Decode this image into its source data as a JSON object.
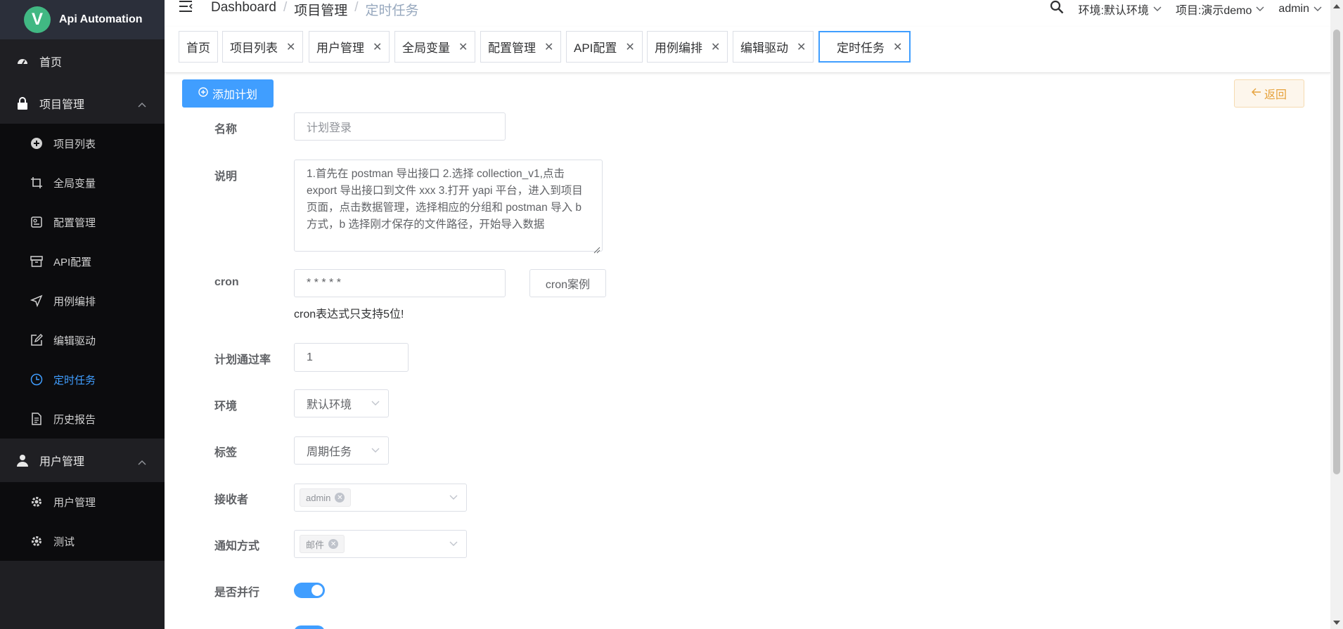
{
  "app": {
    "logo_letter": "V",
    "title": "Api Automation"
  },
  "sidebar": {
    "home": "首页",
    "project_group": "项目管理",
    "project_items": [
      "项目列表",
      "全局变量",
      "配置管理",
      "API配置",
      "用例编排",
      "编辑驱动",
      "定时任务",
      "历史报告"
    ],
    "user_group": "用户管理",
    "user_items": [
      "用户管理",
      "测试"
    ],
    "active_item": "定时任务"
  },
  "breadcrumb": [
    "Dashboard",
    "项目管理",
    "定时任务"
  ],
  "topbar": {
    "env": "环境:默认环境",
    "project": "项目:演示demo",
    "user": "admin"
  },
  "tabs": [
    "首页",
    "项目列表",
    "用户管理",
    "全局变量",
    "配置管理",
    "API配置",
    "用例编排",
    "编辑驱动",
    "定时任务"
  ],
  "actions": {
    "add_plan": "添加计划",
    "back": "返回"
  },
  "form": {
    "name_label": "名称",
    "name_placeholder": "计划登录",
    "desc_label": "说明",
    "desc_value": "1.首先在 postman 导出接口 2.选择 collection_v1,点击 export 导出接口到文件 xxx 3.打开 yapi 平台，进入到项目页面，点击数据管理，选择相应的分组和 postman 导入 b 方式，b 选择刚才保存的文件路径，开始导入数据",
    "cron_label": "cron",
    "cron_value": "* * * * *",
    "cron_example": "cron案例",
    "cron_hint": "cron表达式只支持5位!",
    "pass_rate_label": "计划通过率",
    "pass_rate_value": "1",
    "env_label": "环境",
    "env_value": "默认环境",
    "tag_label": "标签",
    "tag_value": "周期任务",
    "receiver_label": "接收者",
    "receiver_chip": "admin",
    "notify_label": "通知方式",
    "notify_chip": "邮件",
    "parallel_label": "是否并行",
    "parallel_on": true
  },
  "colors": {
    "primary": "#409eff",
    "sidebar_bg": "#1f1f23",
    "warning": "#e6a23c"
  }
}
